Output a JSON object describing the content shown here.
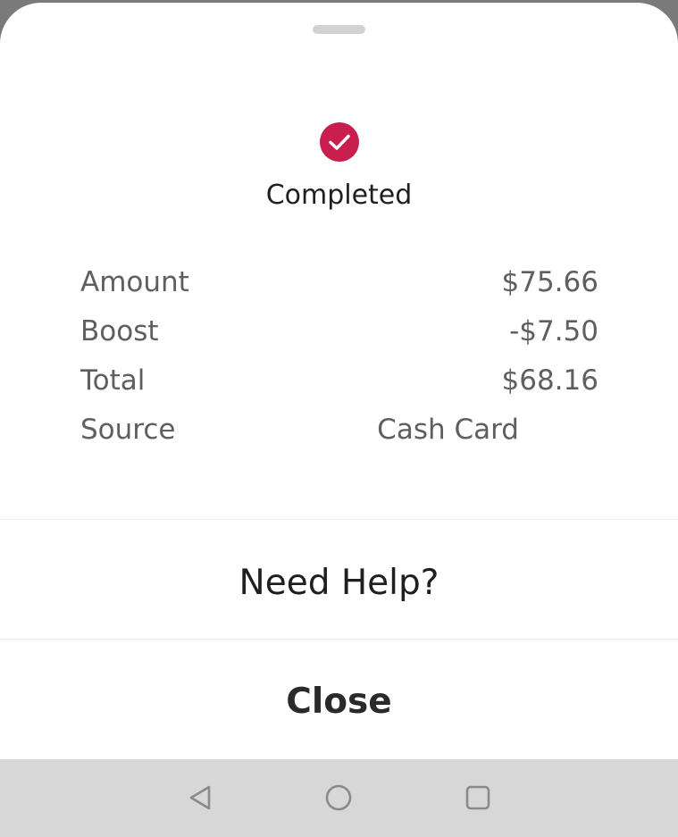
{
  "status": {
    "label": "Completed",
    "icon": "check-circle-icon",
    "color": "#c91f4e"
  },
  "details": [
    {
      "label": "Amount",
      "value": "$75.66"
    },
    {
      "label": "Boost",
      "value": "-$7.50"
    },
    {
      "label": "Total",
      "value": "$68.16"
    },
    {
      "label": "Source",
      "value": "Cash Card"
    }
  ],
  "actions": {
    "help_label": "Need Help?",
    "close_label": "Close"
  },
  "navbar": {
    "icons": [
      "back-icon",
      "home-icon",
      "recents-icon"
    ]
  }
}
